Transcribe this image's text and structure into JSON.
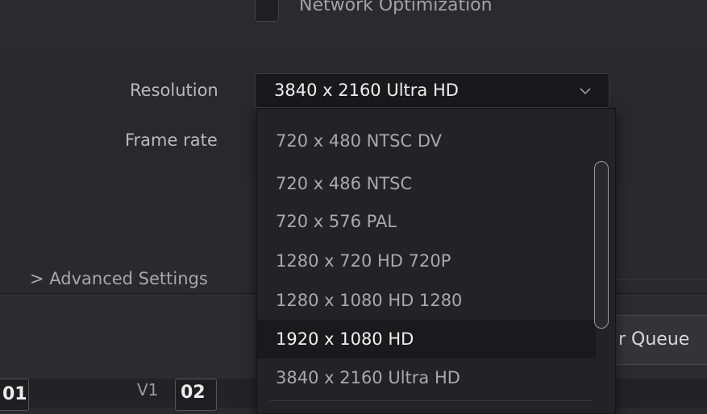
{
  "top": {
    "network_optimization_label": "Network Optimization"
  },
  "form": {
    "resolution_label": "Resolution",
    "resolution_value": "3840 x 2160 Ultra HD",
    "frame_rate_label": "Frame rate"
  },
  "dropdown": {
    "options": [
      {
        "label": "720 x 480 NTSC DV",
        "state": "normal"
      },
      {
        "label": "720 x 486 NTSC",
        "state": "normal"
      },
      {
        "label": "720 x 576 PAL",
        "state": "normal"
      },
      {
        "label": "1280 x 720 HD 720P",
        "state": "normal"
      },
      {
        "label": "1280 x 1080 HD 1280",
        "state": "normal"
      },
      {
        "label": "1920 x 1080 HD",
        "state": "hover"
      },
      {
        "label": "3840 x 2160 Ultra HD",
        "state": "normal"
      }
    ]
  },
  "advanced": {
    "label": "> Advanced Settings"
  },
  "render_queue": {
    "button_label": "r Queue"
  },
  "timeline": {
    "left_timecode": "01",
    "track_label": "V1",
    "right_timecode": "02"
  },
  "icons": {
    "select_chevron": "chevron-down-icon"
  },
  "colors": {
    "panel_bg": "#2a2a2c",
    "dropdown_bg": "#232325",
    "hover_bg": "#1a1a1c",
    "text_primary": "#efeff1",
    "text_muted": "#a9a9ac"
  }
}
